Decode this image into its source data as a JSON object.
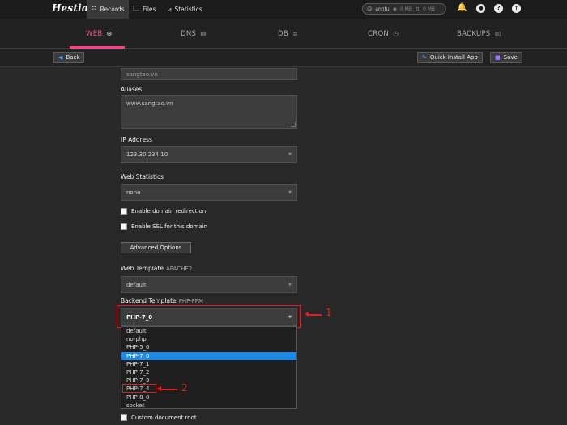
{
  "topbar": {
    "logo": "Hestia",
    "nav": [
      {
        "label": "Records",
        "icon": "list-icon"
      },
      {
        "label": "Files",
        "icon": "folder-icon"
      },
      {
        "label": "Statistics",
        "icon": "chart-icon"
      }
    ],
    "user": {
      "name": "anhtu",
      "disk": "0 MB",
      "bandwidth": "0 MB"
    },
    "icons": [
      "bell-icon",
      "user-icon",
      "help-icon",
      "logout-icon"
    ]
  },
  "tabs": [
    {
      "label": "WEB",
      "icon": "globe-icon",
      "active": true
    },
    {
      "label": "DNS",
      "icon": "dns-icon",
      "active": false
    },
    {
      "label": "DB",
      "icon": "database-icon",
      "active": false
    },
    {
      "label": "CRON",
      "icon": "clock-icon",
      "active": false
    },
    {
      "label": "BACKUPS",
      "icon": "archive-icon",
      "active": false
    }
  ],
  "toolbar": {
    "back_label": "Back",
    "install_label": "Quick Install App",
    "save_label": "Save"
  },
  "form": {
    "domain_value": "sangtao.vn",
    "aliases_label": "Aliases",
    "aliases_value": "www.sangtao.vn",
    "ip_label": "IP Address",
    "ip_value": "123.30.234.10",
    "webstats_label": "Web Statistics",
    "webstats_value": "none",
    "redirect_label": "Enable domain redirection",
    "ssl_label": "Enable SSL for this domain",
    "advanced_label": "Advanced Options",
    "web_template_label": "Web Template",
    "web_template_sub": "APACHE2",
    "web_template_value": "default",
    "backend_template_label": "Backend Template",
    "backend_template_sub": "PHP-FPM",
    "backend_template_value": "PHP-7_0",
    "backend_options": [
      "default",
      "no-php",
      "PHP-5_6",
      "PHP-7_0",
      "PHP-7_1",
      "PHP-7_2",
      "PHP-7_3",
      "PHP-7_4",
      "PHP-8_0",
      "socket"
    ],
    "backend_selected_index": 3,
    "custom_root_label": "Custom document root"
  },
  "annotations": {
    "first": "1",
    "second": "2"
  },
  "colors": {
    "accent": "#ff3c84",
    "select": "#1e88e5",
    "annotation": "#e02020"
  }
}
